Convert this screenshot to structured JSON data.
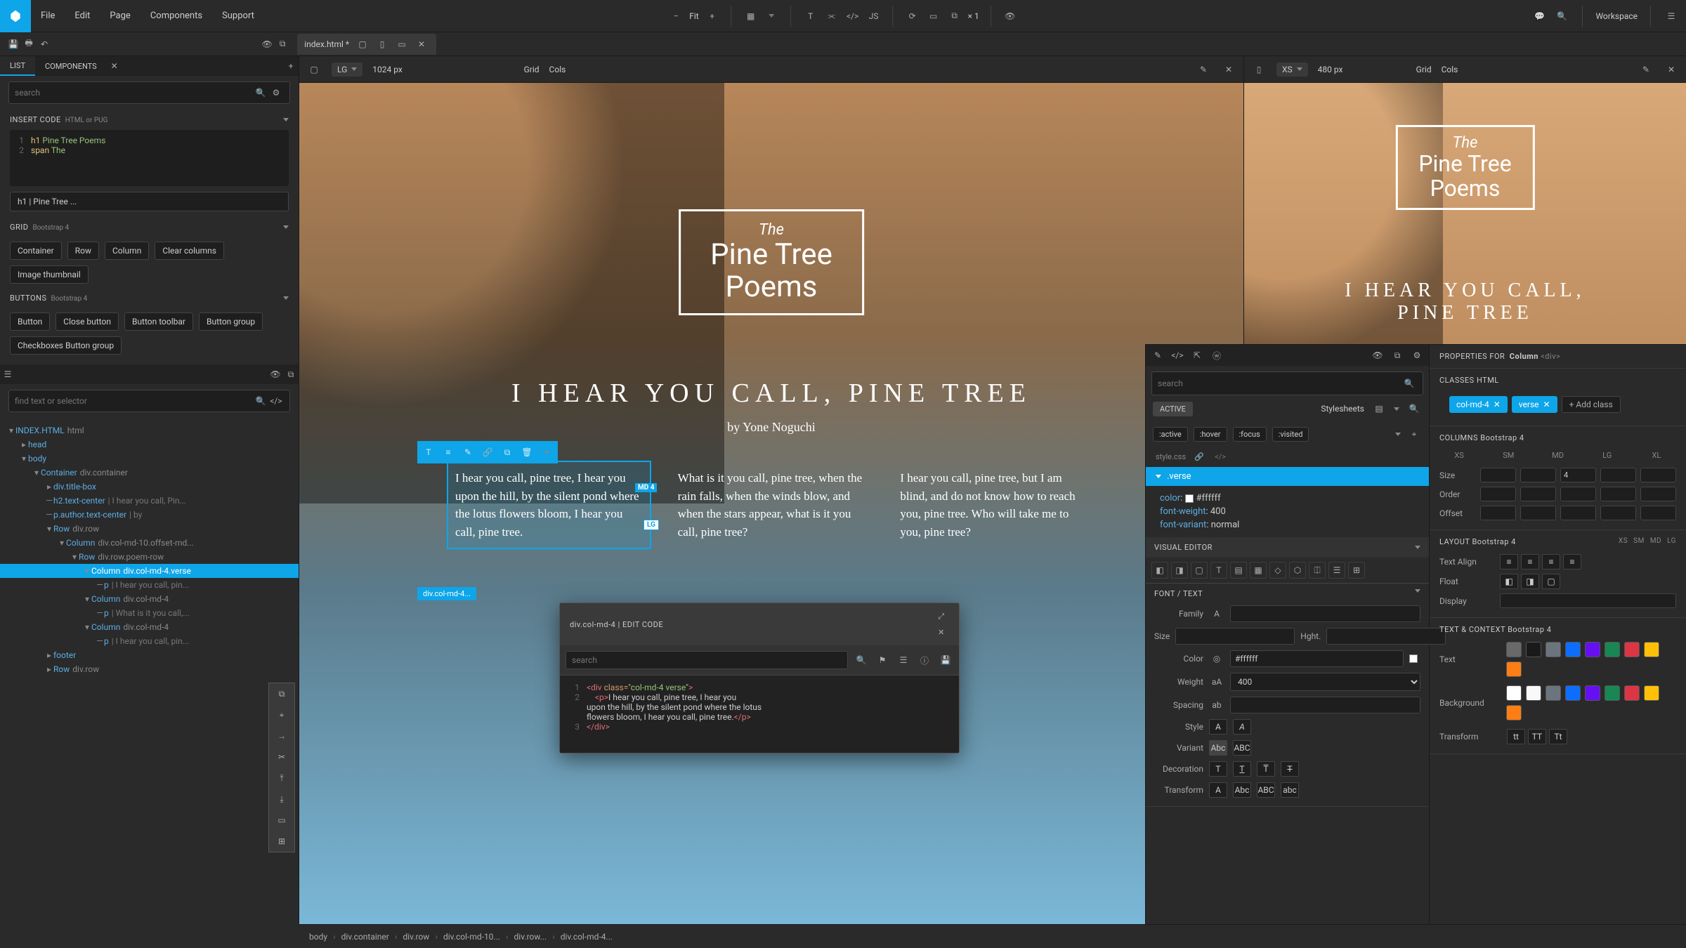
{
  "menu": [
    "File",
    "Edit",
    "Page",
    "Components",
    "Support"
  ],
  "topcenter": {
    "fit": "Fit",
    "mult": "× 1"
  },
  "workspace": "Workspace",
  "tab": {
    "name": "index.html *"
  },
  "viewport_lg": {
    "device": "LG",
    "size": "1024 px",
    "grid": "Grid",
    "cols": "Cols"
  },
  "viewport_xs": {
    "device": "XS",
    "size": "480 px",
    "grid": "Grid",
    "cols": "Cols"
  },
  "panel_tabs": {
    "list": "LIST",
    "components": "COMPONENTS"
  },
  "search_placeholder": "search",
  "insert_code": {
    "label": "INSERT CODE",
    "sub": "HTML or PUG",
    "lines": [
      {
        "n": "1",
        "tokens": [
          {
            "t": "kw",
            "v": "h1"
          },
          {
            "t": "str",
            "v": "  Pine Tree Poems"
          }
        ]
      },
      {
        "n": "2",
        "tokens": [
          {
            "t": "",
            "v": "    "
          },
          {
            "t": "kw",
            "v": "span"
          },
          {
            "t": "str",
            "v": "  The"
          }
        ]
      }
    ],
    "result": "h1 | Pine Tree ..."
  },
  "grid_section": {
    "label": "GRID",
    "sub": "Bootstrap 4",
    "buttons": [
      "Container",
      "Row",
      "Column",
      "Clear columns",
      "Image thumbnail"
    ]
  },
  "buttons_section": {
    "label": "BUTTONS",
    "sub": "Bootstrap 4",
    "buttons": [
      "Button",
      "Close button",
      "Button toolbar",
      "Button group",
      "Checkboxes Button group"
    ]
  },
  "tree_search_placeholder": "find text or selector",
  "tree": [
    {
      "depth": 0,
      "arr": "▾",
      "tag": "INDEX.HTML",
      "cls": "html"
    },
    {
      "depth": 1,
      "arr": "▸",
      "tag": "head"
    },
    {
      "depth": 1,
      "arr": "▾",
      "tag": "body"
    },
    {
      "depth": 2,
      "arr": "▾",
      "tag": "Container",
      "cls": "div.container"
    },
    {
      "depth": 3,
      "arr": "▸",
      "tag": "div.title-box"
    },
    {
      "depth": 3,
      "arr": "—",
      "tag": "h2.text-center",
      "txt": " | I hear you call, Pin..."
    },
    {
      "depth": 3,
      "arr": "—",
      "tag": "p.author.text-center",
      "txt": " | by"
    },
    {
      "depth": 3,
      "arr": "▾",
      "tag": "Row",
      "cls": "div.row"
    },
    {
      "depth": 4,
      "arr": "▾",
      "tag": "Column",
      "cls": "div.col-md-10.offset-md..."
    },
    {
      "depth": 5,
      "arr": "▾",
      "tag": "Row",
      "cls": "div.row.poem-row"
    },
    {
      "depth": 6,
      "arr": "▾",
      "tag": "Column",
      "cls": "div.col-md-4.verse",
      "selected": true
    },
    {
      "depth": 7,
      "arr": "—",
      "tag": "p",
      "txt": " | I hear you call, pin..."
    },
    {
      "depth": 6,
      "arr": "▾",
      "tag": "Column",
      "cls": "div.col-md-4"
    },
    {
      "depth": 7,
      "arr": "—",
      "tag": "p",
      "txt": " | What is it you call,..."
    },
    {
      "depth": 6,
      "arr": "▾",
      "tag": "Column",
      "cls": "div.col-md-4"
    },
    {
      "depth": 7,
      "arr": "—",
      "tag": "p",
      "txt": " | I hear you call, pin..."
    },
    {
      "depth": 3,
      "arr": "▸",
      "tag": "footer"
    },
    {
      "depth": 3,
      "arr": "▸",
      "tag": "Row",
      "cls": "div.row"
    }
  ],
  "page": {
    "the": "The",
    "title": "Pine Tree\nPoems",
    "h": "I HEAR YOU CALL, PINE TREE",
    "author": "by Yone Noguchi",
    "verses": [
      "I hear you call, pine tree, I hear you upon the hill, by the silent pond where the lotus flowers bloom, I hear you call, pine tree.",
      "What is it you call, pine tree, when the rain falls, when the winds blow, and when the stars appear, what is it you call, pine tree?",
      "I hear you call, pine tree, but I am blind, and do not know how to reach you, pine tree. Who will take me to you, pine tree?"
    ],
    "sel_label": "div.col-md-4...",
    "badge_md": "MD 4",
    "badge_lg": "LG"
  },
  "editcode": {
    "title": "div.col-md-4 | EDIT CODE",
    "search": "search",
    "lines": [
      {
        "n": "1",
        "html": "<div class=\"col-md-4 verse\">"
      },
      {
        "n": "2",
        "html": "    <p>I hear you call, pine tree, I hear you upon the hill, by the silent pond where the lotus flowers bloom, I hear you call, pine tree.</p>"
      },
      {
        "n": "3",
        "html": "</div>"
      }
    ]
  },
  "style_panel": {
    "search": "search",
    "active": "ACTIVE",
    "stylesheets": "Stylesheets",
    "pseudos": [
      ":active",
      ":hover",
      ":focus",
      ":visited"
    ],
    "source": "style.css",
    "rule": ".verse",
    "props": [
      {
        "k": "color",
        "v": "#ffffff",
        "swatch": true
      },
      {
        "k": "font-weight",
        "v": "400"
      },
      {
        "k": "font-variant",
        "v": "normal"
      }
    ],
    "visual_editor": "VISUAL EDITOR",
    "font_text": "FONT / TEXT",
    "fields": {
      "family": "Family",
      "size": "Size",
      "hght": "Hght.",
      "color": "Color",
      "color_val": "#ffffff",
      "weight": "Weight",
      "weight_val": "400",
      "spacing": "Spacing",
      "style": "Style",
      "variant": "Variant",
      "decoration": "Decoration",
      "transform": "Transform"
    },
    "variant_opts": [
      "Abc",
      "ABC"
    ],
    "transform_opts": [
      "A",
      "Abc",
      "ABC",
      "abc"
    ]
  },
  "props_panel": {
    "head": "PROPERTIES FOR",
    "el": "Column",
    "tag": "<div>",
    "classes": "CLASSES",
    "classes_sub": "HTML",
    "class_chips": [
      "col-md-4",
      "verse"
    ],
    "add_class": "+ Add class",
    "columns": "COLUMNS",
    "columns_sub": "Bootstrap 4",
    "bps": [
      "XS",
      "SM",
      "MD",
      "LG",
      "XL"
    ],
    "size": "Size",
    "size_md": "4",
    "order": "Order",
    "offset": "Offset",
    "layout": "LAYOUT",
    "layout_sub": "Bootstrap 4",
    "layout_bps": [
      "XS",
      "SM",
      "MD",
      "LG"
    ],
    "text_align": "Text Align",
    "float": "Float",
    "display": "Display",
    "text_context": "TEXT & CONTEXT",
    "tc_sub": "Bootstrap 4",
    "text": "Text",
    "background": "Background",
    "transform": "Transform",
    "text_colors": [
      "#696969",
      "#1a1a1a",
      "#6c757d",
      "#0d6efd",
      "#6610f2",
      "#198754",
      "#dc3545",
      "#ffc107",
      "#fd7e14"
    ],
    "bg_colors": [
      "#ffffff",
      "#f8f9fa",
      "#6c757d",
      "#0d6efd",
      "#6610f2",
      "#198754",
      "#dc3545",
      "#ffc107",
      "#fd7e14"
    ]
  },
  "crumbs": [
    "body",
    "div.container",
    "div.row",
    "div.col-md-10...",
    "div.row...",
    "div.col-md-4..."
  ]
}
